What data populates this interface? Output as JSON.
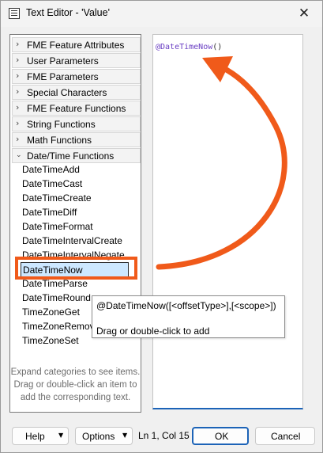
{
  "window": {
    "title": "Text Editor - 'Value'",
    "close_glyph": "✕"
  },
  "categories": [
    {
      "label": "FME Feature Attributes",
      "expanded": false
    },
    {
      "label": "User Parameters",
      "expanded": false
    },
    {
      "label": "FME Parameters",
      "expanded": false
    },
    {
      "label": "Special Characters",
      "expanded": false
    },
    {
      "label": "FME Feature Functions",
      "expanded": false
    },
    {
      "label": "String Functions",
      "expanded": false
    },
    {
      "label": "Math Functions",
      "expanded": false
    },
    {
      "label": "Date/Time Functions",
      "expanded": true
    }
  ],
  "datetime_functions": [
    "DateTimeAdd",
    "DateTimeCast",
    "DateTimeCreate",
    "DateTimeDiff",
    "DateTimeFormat",
    "DateTimeIntervalCreate",
    "DateTimeIntervalNegate",
    "DateTimeNow",
    "DateTimeParse",
    "DateTimeRound",
    "TimeZoneGet",
    "TimeZoneRemove",
    "TimeZoneSet"
  ],
  "selected_function": "DateTimeNow",
  "help_text": "Expand categories to see items. Drag or double-click an item to add the corresponding text.",
  "editor": {
    "function_name": "@DateTimeNow",
    "args": "()"
  },
  "tooltip": {
    "signature": "@DateTimeNow([<offsetType>],[<scope>])",
    "hint": "Drag or double-click to add"
  },
  "footer": {
    "help_label": "Help",
    "options_label": "Options",
    "cursor_position": "Ln 1, Col 15",
    "ok_label": "OK",
    "cancel_label": "Cancel",
    "dropdown_glyph": "▼"
  },
  "colors": {
    "annotation": "#f05a1a",
    "accent": "#1c63b7",
    "selection": "#cde8ff"
  },
  "icons": {
    "collapsed": "chevron-right-icon",
    "expanded": "chevron-down-icon"
  }
}
